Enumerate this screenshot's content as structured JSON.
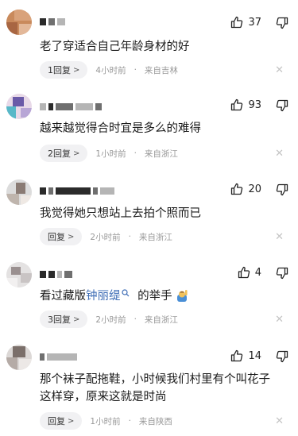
{
  "comments": [
    {
      "likes": "37",
      "text": "老了穿适合自己年龄身材的好",
      "reply": "1回复",
      "time": "4小时前",
      "location": "来自吉林"
    },
    {
      "likes": "93",
      "text": "越来越觉得合时宜是多么的难得",
      "reply": "2回复",
      "time": "1小时前",
      "location": "来自浙江"
    },
    {
      "likes": "20",
      "text": "我觉得她只想站上去拍个照而已",
      "reply": "回复",
      "time": "2小时前",
      "location": "来自浙江"
    },
    {
      "likes": "4",
      "text_before": "看过藏版",
      "text_link": "钟丽缇",
      "text_after": "的举手",
      "reply": "3回复",
      "time": "2小时前",
      "location": "来自浙江"
    },
    {
      "likes": "14",
      "text_line1": "那个袜子配拖鞋，小时候我们村里有个叫花子",
      "text_line2": "这样穿，原来这就是时尚",
      "reply": "回复",
      "time": "1小时前",
      "location": "来自陕西"
    }
  ],
  "ui": {
    "chevron": ">",
    "dot": "·",
    "close": "✕"
  },
  "icons": {
    "like": "thumbs-up-icon",
    "dislike": "thumbs-down-icon",
    "search": "search-icon",
    "emoji": "raising-hand-emoji",
    "close": "close-icon"
  },
  "colors": {
    "link": "#3d6cb5",
    "meta": "#999999",
    "pill": "#f1f1f3"
  }
}
